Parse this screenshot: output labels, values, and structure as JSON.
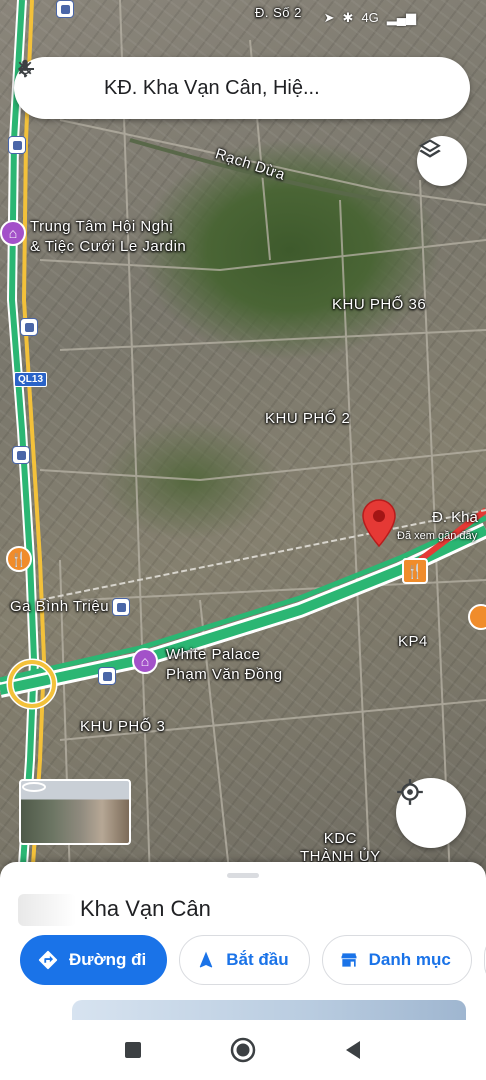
{
  "status_bar": {
    "network": "4G"
  },
  "search": {
    "query": "KĐ. Kha Vạn Cân, Hiệ..."
  },
  "map": {
    "labels": {
      "street_so2": "Đ. Số 2",
      "rach_dua": "Rạch Dừa",
      "poi_le_jardin": "Trung Tâm Hội Nghị\n& Tiệc Cưới Le Jardin",
      "khu_pho_36": "KHU PHỐ 36",
      "khu_pho_2": "KHU PHỐ 2",
      "khu_pho_3": "KHU PHỐ 3",
      "kp4": "KP4",
      "kdc_thanh_uy": "KDC\nTHÀNH ỦY",
      "ga_binh_trieu": "Ga Bình Triệu",
      "white_palace": "White Palace\nPhạm Văn Đồng",
      "road_shield": "QL13"
    },
    "destination": {
      "label": "Đ. Kha",
      "sublabel": "Đã xem gần đây"
    }
  },
  "place": {
    "title": "Kha Vạn Cân"
  },
  "actions": {
    "directions": "Đường đi",
    "start": "Bắt đầu",
    "save": "Danh mục"
  },
  "colors": {
    "accent": "#1a73e8",
    "pin_red": "#e53935",
    "road_green": "#2bb673",
    "road_yellow": "#f3c13a"
  }
}
